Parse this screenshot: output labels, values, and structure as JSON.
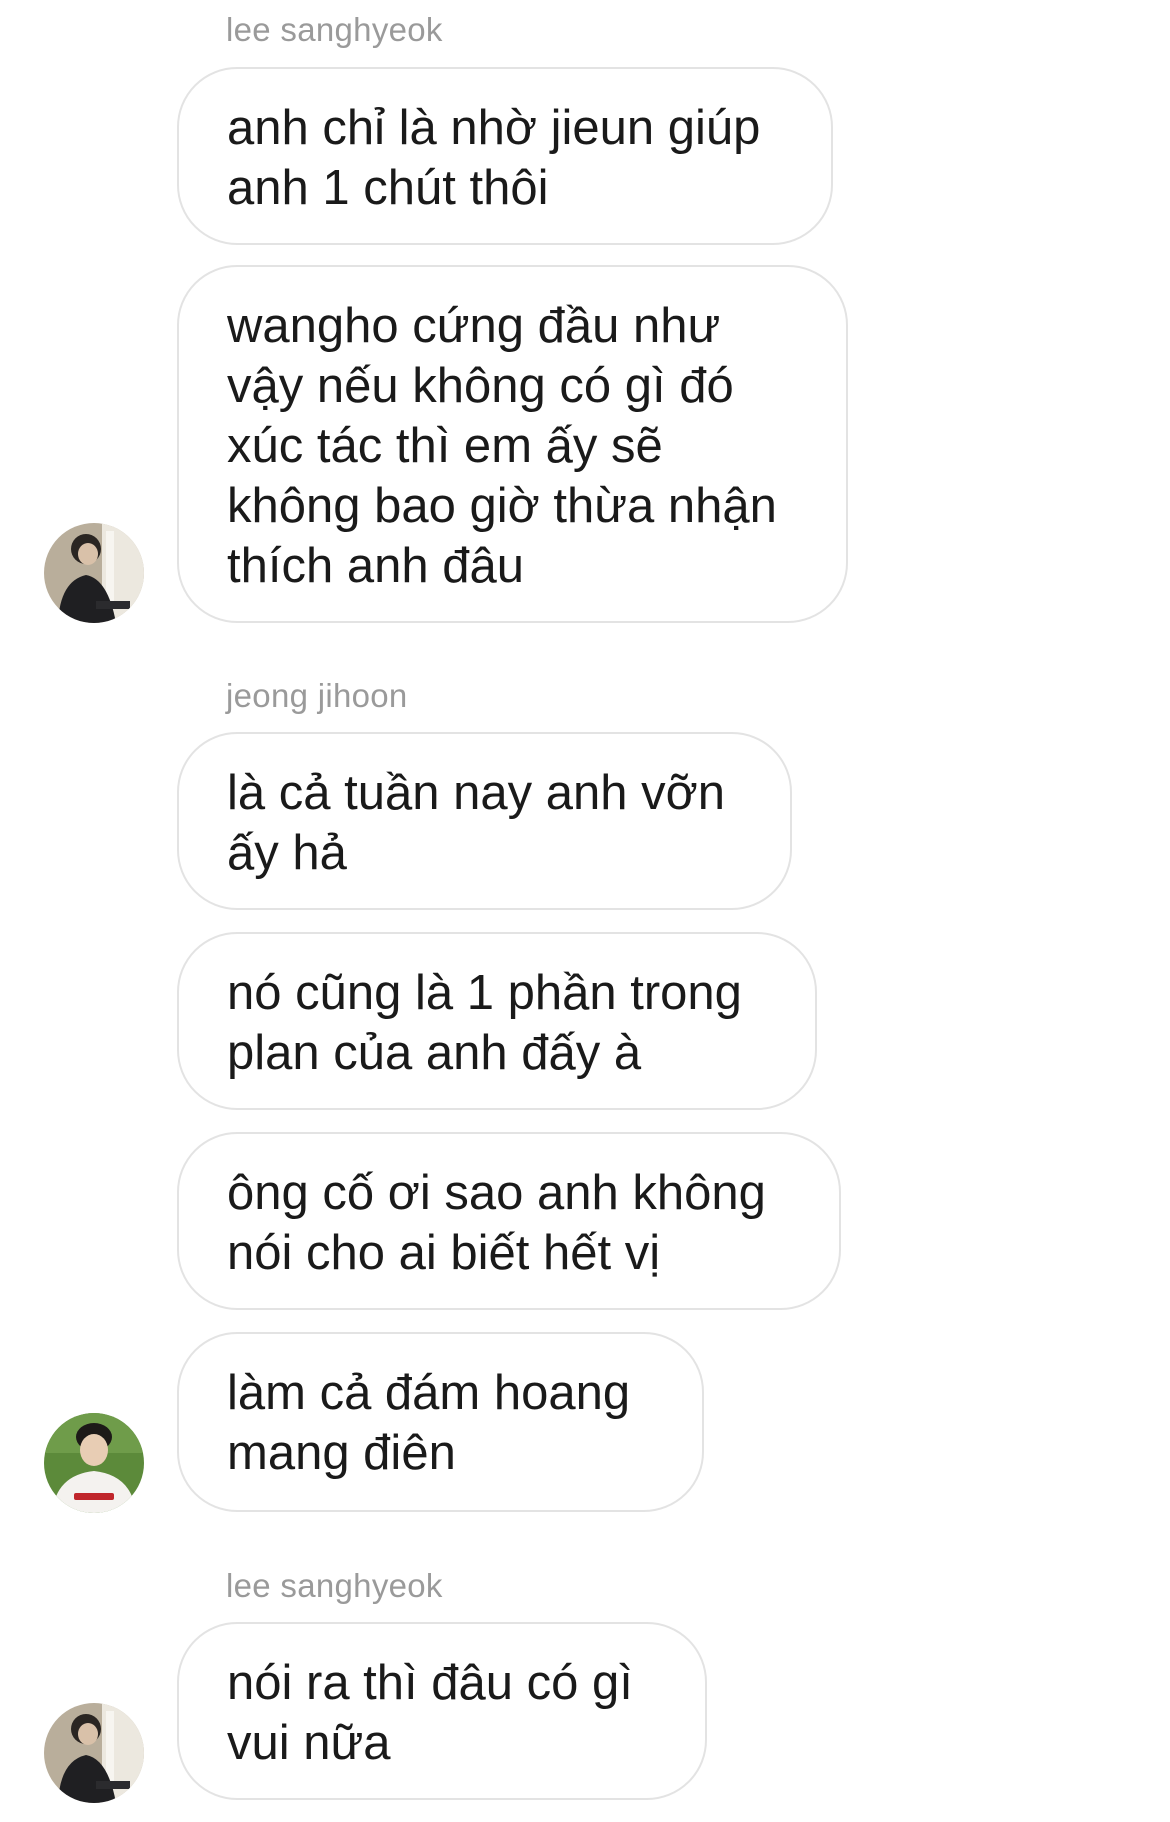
{
  "conversation": {
    "groups": [
      {
        "sender": "lee sanghyeok",
        "messages": [
          "anh chỉ là nhờ jieun giúp\nanh 1 chút thôi",
          "wangho cứng đầu như\nvậy nếu không có gì đó\nxúc tác thì em ấy sẽ\nkhông bao giờ thừa nhận\nthích anh đâu"
        ],
        "avatar_icon": "profile-avatar-icon"
      },
      {
        "sender": "jeong jihoon",
        "messages": [
          "là cả tuần nay anh vỡn\nấy hả",
          "nó cũng là 1 phần trong\nplan của anh đấy à",
          "ông cố ơi sao anh không\nnói cho ai biết hết vị",
          "làm cả đám hoang\nmang điên"
        ],
        "avatar_icon": "profile-avatar-icon"
      },
      {
        "sender": "lee sanghyeok",
        "messages": [
          "nói ra thì đâu có gì\nvui nữa"
        ],
        "avatar_icon": "profile-avatar-icon"
      }
    ]
  },
  "colors": {
    "background": "#ffffff",
    "bubble_border": "#e3e3e3",
    "message_text": "#1a1a1a",
    "sender_text": "#9a9a9a"
  }
}
